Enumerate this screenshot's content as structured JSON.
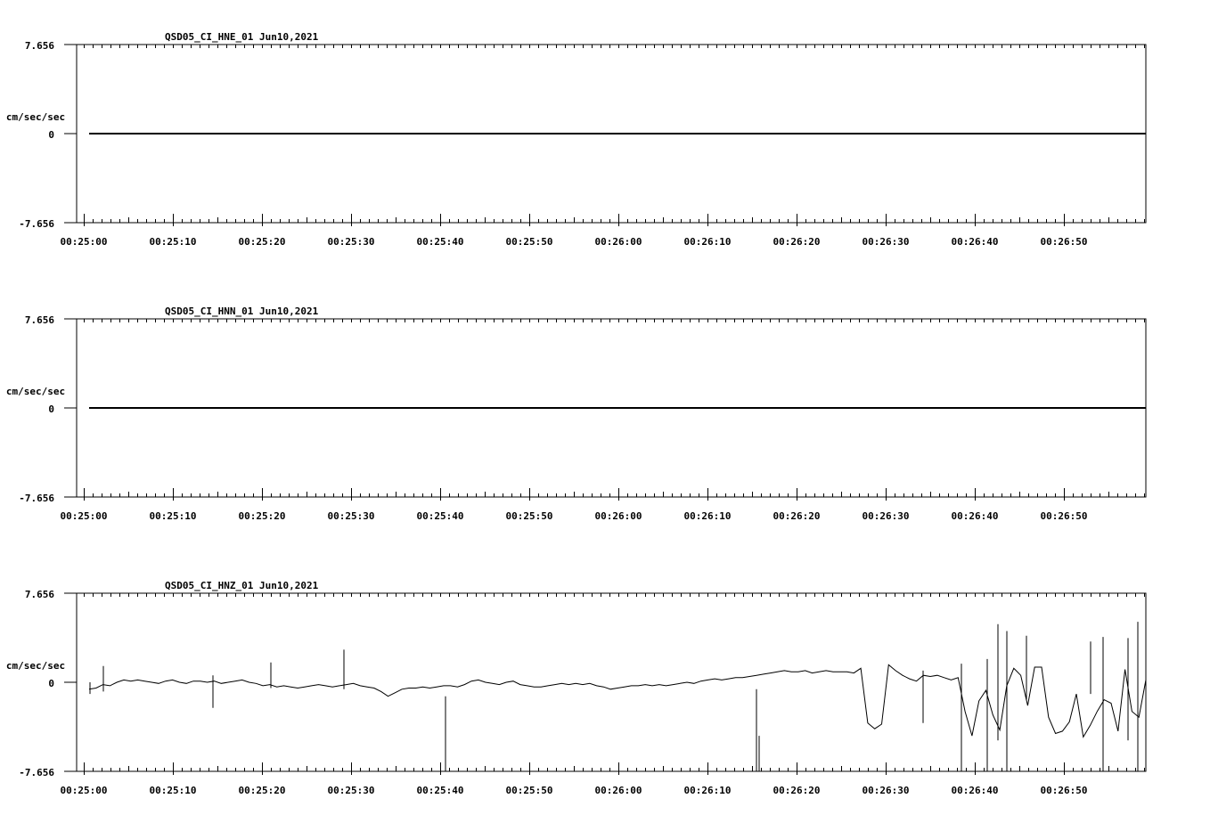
{
  "chart_data": [
    {
      "type": "line",
      "title": "QSD05_CI_HNE_01  Jun10,2021",
      "ylabel": "cm/sec/sec",
      "ytick_labels": [
        "7.656",
        "0",
        "-7.656"
      ],
      "ylim": [
        -7.656,
        7.656
      ],
      "xlim_seconds": [
        -0.8,
        119.2
      ],
      "xtick_labels": [
        "00:25:00",
        "00:25:10",
        "00:25:20",
        "00:25:30",
        "00:25:40",
        "00:25:50",
        "00:26:00",
        "00:26:10",
        "00:26:20",
        "00:26:30",
        "00:26:40",
        "00:26:50"
      ],
      "series": [
        {
          "x_start": 0.6,
          "x_end": 119.2,
          "values": [
            0.0,
            0.0
          ]
        }
      ]
    },
    {
      "type": "line",
      "title": "QSD05_CI_HNN_01  Jun10,2021",
      "ylabel": "cm/sec/sec",
      "ytick_labels": [
        "7.656",
        "0",
        "-7.656"
      ],
      "ylim": [
        -7.656,
        7.656
      ],
      "xlim_seconds": [
        -0.8,
        119.2
      ],
      "xtick_labels": [
        "00:25:00",
        "00:25:10",
        "00:25:20",
        "00:25:30",
        "00:25:40",
        "00:25:50",
        "00:26:00",
        "00:26:10",
        "00:26:20",
        "00:26:30",
        "00:26:40",
        "00:26:50"
      ],
      "series": [
        {
          "x_start": 0.6,
          "x_end": 119.2,
          "values": [
            0.0,
            0.0
          ]
        }
      ]
    },
    {
      "type": "line",
      "title": "QSD05_CI_HNZ_01  Jun10,2021",
      "ylabel": "cm/sec/sec",
      "ytick_labels": [
        "7.656",
        "0",
        "-7.656"
      ],
      "ylim": [
        -7.656,
        7.656
      ],
      "xlim_seconds": [
        -0.8,
        119.2
      ],
      "xtick_labels": [
        "00:25:00",
        "00:25:10",
        "00:25:20",
        "00:25:30",
        "00:25:40",
        "00:25:50",
        "00:26:00",
        "00:26:10",
        "00:26:20",
        "00:26:30",
        "00:26:40",
        "00:26:50"
      ],
      "series": [
        {
          "x_start": 0.6,
          "x_end": 119.2,
          "values": [
            -0.6,
            -0.5,
            -0.2,
            -0.3,
            0.0,
            0.2,
            0.1,
            0.2,
            0.1,
            0.0,
            -0.1,
            0.1,
            0.2,
            0.0,
            -0.1,
            0.1,
            0.1,
            0.0,
            0.1,
            -0.1,
            0.0,
            0.1,
            0.2,
            0.0,
            -0.1,
            -0.3,
            -0.2,
            -0.4,
            -0.3,
            -0.4,
            -0.5,
            -0.4,
            -0.3,
            -0.2,
            -0.3,
            -0.4,
            -0.3,
            -0.2,
            -0.1,
            -0.3,
            -0.4,
            -0.5,
            -0.8,
            -1.2,
            -0.9,
            -0.6,
            -0.5,
            -0.5,
            -0.4,
            -0.5,
            -0.4,
            -0.3,
            -0.3,
            -0.4,
            -0.2,
            0.1,
            0.2,
            0.0,
            -0.1,
            -0.2,
            0.0,
            0.1,
            -0.2,
            -0.3,
            -0.4,
            -0.4,
            -0.3,
            -0.2,
            -0.1,
            -0.2,
            -0.1,
            -0.2,
            -0.1,
            -0.3,
            -0.4,
            -0.6,
            -0.5,
            -0.4,
            -0.3,
            -0.3,
            -0.2,
            -0.3,
            -0.2,
            -0.3,
            -0.2,
            -0.1,
            0.0,
            -0.1,
            0.1,
            0.2,
            0.3,
            0.2,
            0.3,
            0.4,
            0.4,
            0.5,
            0.6,
            0.7,
            0.8,
            0.9,
            1.0,
            0.9,
            0.9,
            1.0,
            0.8,
            0.9,
            1.0,
            0.9,
            0.9,
            0.9,
            0.8,
            1.2,
            -3.5,
            -4.0,
            -3.6,
            1.5,
            1.0,
            0.6,
            0.3,
            0.1,
            0.6,
            0.5,
            0.6,
            0.4,
            0.2,
            0.4,
            -2.5,
            -4.6,
            -1.6,
            -0.7,
            -2.8,
            -4.1,
            -0.3,
            1.2,
            0.6,
            -2.0,
            1.3,
            1.3,
            -3.0,
            -4.4,
            -4.2,
            -3.4,
            -1.0,
            -4.7,
            -3.7,
            -2.5,
            -1.5,
            -1.8,
            -4.2,
            1.1,
            -2.5,
            -3.0,
            0.2
          ]
        }
      ],
      "spikes": [
        {
          "x": 0.7,
          "y_min": -1.0,
          "y_max": 0.0
        },
        {
          "x": 2.2,
          "y_min": -0.8,
          "y_max": 1.4
        },
        {
          "x": 14.5,
          "y_min": -2.2,
          "y_max": 0.6
        },
        {
          "x": 21.0,
          "y_min": -0.5,
          "y_max": 1.7
        },
        {
          "x": 29.2,
          "y_min": -0.6,
          "y_max": 2.8
        },
        {
          "x": 40.6,
          "y_min": -10.4,
          "y_max": -1.2
        },
        {
          "x": 75.5,
          "y_min": -8.8,
          "y_max": -0.6
        },
        {
          "x": 75.8,
          "y_min": -10.6,
          "y_max": -4.6
        },
        {
          "x": 94.2,
          "y_min": -3.5,
          "y_max": 1.0
        },
        {
          "x": 98.5,
          "y_min": -9.5,
          "y_max": 1.6
        },
        {
          "x": 101.4,
          "y_min": -9.8,
          "y_max": 2.0
        },
        {
          "x": 102.6,
          "y_min": -5.0,
          "y_max": 5.0
        },
        {
          "x": 103.6,
          "y_min": -11.8,
          "y_max": 4.4
        },
        {
          "x": 105.8,
          "y_min": -1.5,
          "y_max": 4.0
        },
        {
          "x": 113.0,
          "y_min": -1.0,
          "y_max": 3.5
        },
        {
          "x": 114.4,
          "y_min": -8.5,
          "y_max": 3.9
        },
        {
          "x": 117.2,
          "y_min": -5.0,
          "y_max": 3.8
        },
        {
          "x": 118.3,
          "y_min": -10.8,
          "y_max": 5.2
        }
      ]
    }
  ]
}
